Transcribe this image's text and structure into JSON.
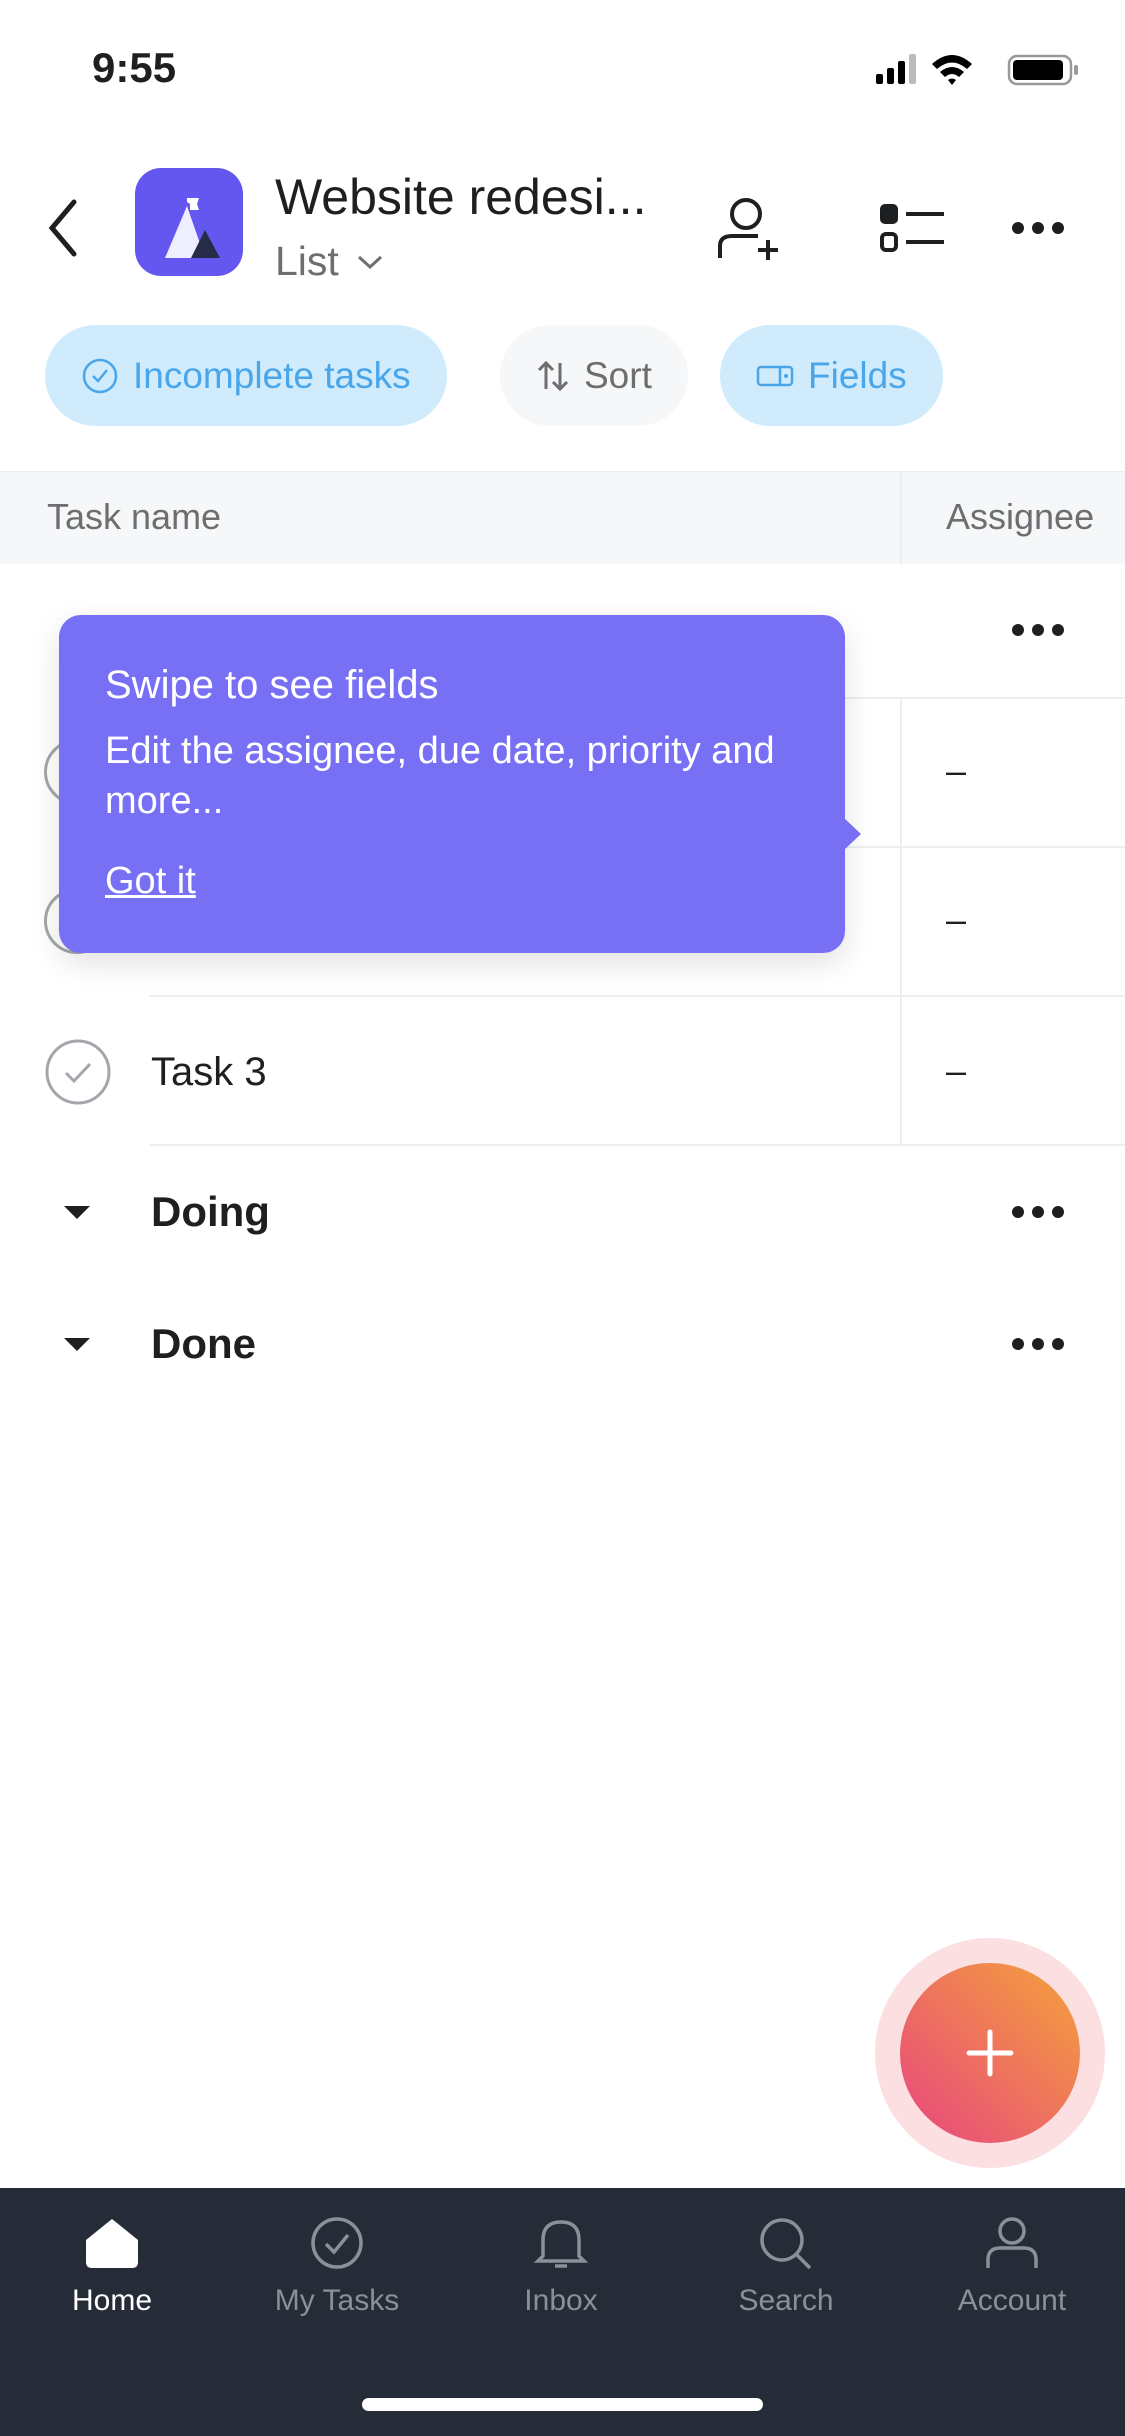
{
  "status_bar": {
    "time": "9:55"
  },
  "header": {
    "title": "Website redesi...",
    "view": "List",
    "accent": "#6457f0"
  },
  "chips": [
    {
      "label": "Incomplete tasks",
      "icon": "check-circle-icon"
    },
    {
      "label": "Sort",
      "icon": "sort-icon"
    },
    {
      "label": "Fields",
      "icon": "fields-icon"
    }
  ],
  "table": {
    "columns": [
      "Task name",
      "Assignee"
    ],
    "rows": [
      {
        "name": "",
        "assignee": "–"
      },
      {
        "name": "",
        "assignee": "–"
      },
      {
        "name": "Task 3",
        "assignee": "–"
      }
    ]
  },
  "sections": [
    {
      "label": "Doing"
    },
    {
      "label": "Done"
    }
  ],
  "tooltip": {
    "title": "Swipe to see fields",
    "body": "Edit the assignee, due date, priority and more...",
    "action": "Got it",
    "color": "#7870f4"
  },
  "tabs": [
    {
      "label": "Home",
      "icon": "home-icon",
      "active": true
    },
    {
      "label": "My Tasks",
      "icon": "check-circle-icon"
    },
    {
      "label": "Inbox",
      "icon": "bell-icon"
    },
    {
      "label": "Search",
      "icon": "search-icon"
    },
    {
      "label": "Account",
      "icon": "person-icon"
    }
  ]
}
